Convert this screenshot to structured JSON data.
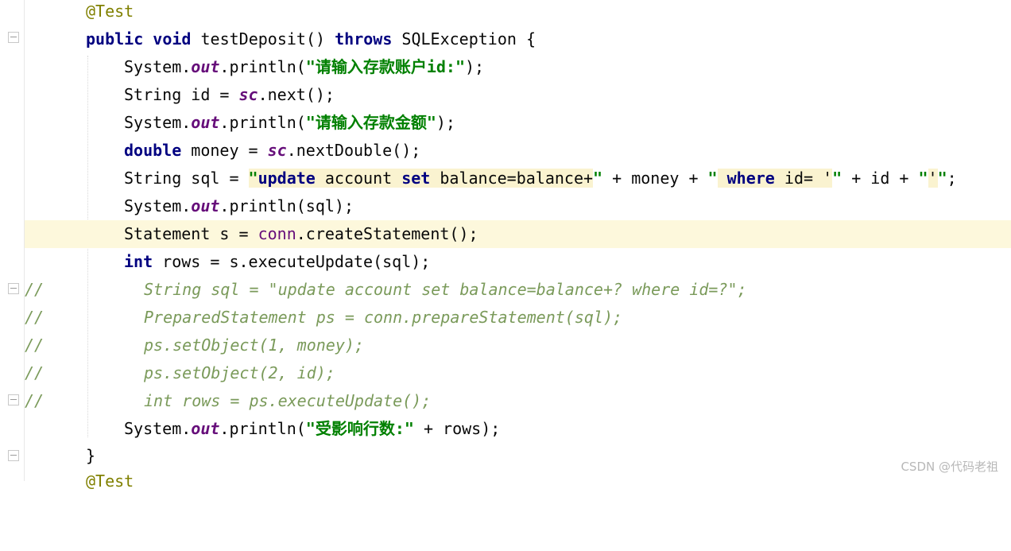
{
  "editor": {
    "lines": {
      "l0": {
        "anno": "@Test"
      },
      "l1": {
        "kw1": "public",
        "kw2": "void",
        "name": "testDeposit()",
        "kw3": "throws",
        "rest": "SQLException {"
      },
      "l2": {
        "a": "System.",
        "f": "out",
        "b": ".println(",
        "s": "\"请输入存款账户id:\"",
        "c": ");"
      },
      "l3": {
        "a": "String id = ",
        "f": "sc",
        "b": ".next();"
      },
      "l4": {
        "a": "System.",
        "f": "out",
        "b": ".println(",
        "s": "\"请输入存款金额\"",
        "c": ");"
      },
      "l5": {
        "kw": "double",
        "a": " money = ",
        "f": "sc",
        "b": ".nextDouble();"
      },
      "l6": {
        "a": "String sql = ",
        "q1": "\"",
        "k1": "update",
        "t1": " account ",
        "k2": "set",
        "t2": " balance=balance+",
        "q2": "\"",
        "m": " + money + ",
        "q3": "\"",
        "sp": " ",
        "k3": "where",
        "t3": " id= '",
        "q4": "\"",
        "m2": " + id + ",
        "q5": "\"",
        "t4": "'",
        "q6": "\"",
        "end": ";"
      },
      "l7": {
        "a": "System.",
        "f": "out",
        "b": ".println(sql);"
      },
      "l8": {
        "a": "Statement s = ",
        "f": "conn",
        "b": ".createStatement();"
      },
      "l9": {
        "kw": "int",
        "a": " rows = s.executeUpdate(sql);"
      },
      "l10": {
        "slash": "//",
        "body": "String sql = \"update account set balance=balance+? where id=?\";"
      },
      "l11": {
        "slash": "//",
        "body": "PreparedStatement ps = conn.prepareStatement(sql);"
      },
      "l12": {
        "slash": "//",
        "body": "ps.setObject(1, money);"
      },
      "l13": {
        "slash": "//",
        "body": "ps.setObject(2, id);"
      },
      "l14": {
        "slash": "//",
        "body": "int rows = ps.executeUpdate();"
      },
      "l15": {
        "a": "System.",
        "f": "out",
        "b": ".println(",
        "s": "\"受影响行数:\"",
        "c": " + rows);"
      },
      "l16": {
        "a": "}"
      },
      "l17": {
        "anno": "@Test"
      }
    }
  },
  "watermark": "CSDN @代码老祖"
}
